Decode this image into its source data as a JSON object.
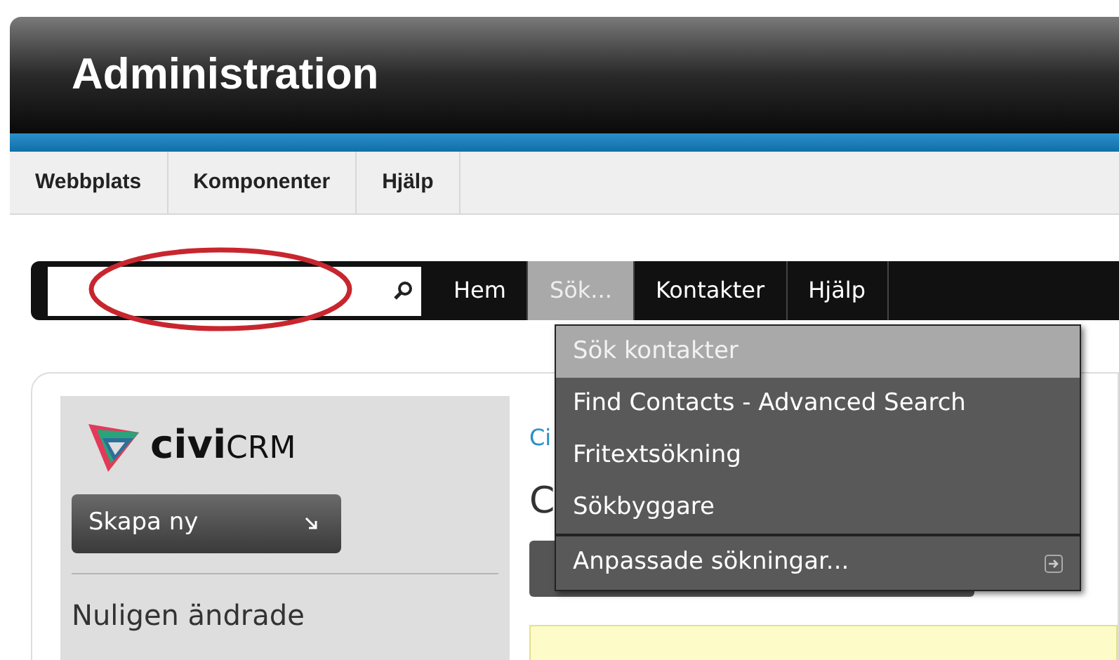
{
  "header": {
    "title": "Administration"
  },
  "admin_menu": [
    {
      "label": "Webbplats"
    },
    {
      "label": "Komponenter"
    },
    {
      "label": "Hjälp"
    }
  ],
  "nav": {
    "items": [
      {
        "label": "Hem",
        "selected": false
      },
      {
        "label": "Sök...",
        "selected": true
      },
      {
        "label": "Kontakter",
        "selected": false
      },
      {
        "label": "Hjälp",
        "selected": false
      }
    ]
  },
  "dropdown": {
    "items": [
      {
        "label": "Sök kontakter",
        "selected": true,
        "kind": "item"
      },
      {
        "label": "Find Contacts - Advanced Search",
        "selected": false,
        "kind": "item"
      },
      {
        "label": "Fritextsökning",
        "selected": false,
        "kind": "item"
      },
      {
        "label": "Sökbyggare",
        "selected": false,
        "kind": "item"
      },
      {
        "label": "Anpassade sökningar...",
        "selected": false,
        "kind": "submenu"
      }
    ]
  },
  "sidebar": {
    "logo": {
      "first": "civi",
      "second": "CRM"
    },
    "create_button": "Skapa ny",
    "section_title": "Nuligen ändrade"
  },
  "main": {
    "link": "Ci",
    "heading": "C"
  }
}
